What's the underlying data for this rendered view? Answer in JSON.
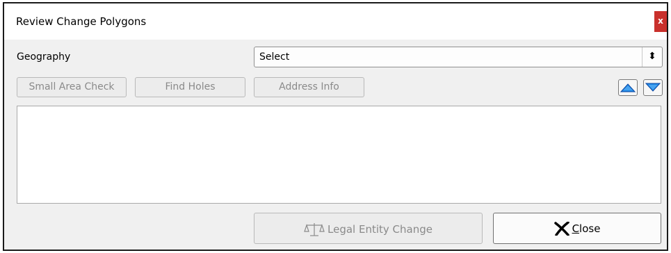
{
  "window": {
    "title": "Review Change Polygons",
    "close_glyph": "x"
  },
  "geography": {
    "label": "Geography",
    "selected": "Select"
  },
  "toolbar": {
    "small_area_check": "Small Area Check",
    "find_holes": "Find Holes",
    "address_info": "Address Info",
    "move_up_icon": "up-arrow-icon",
    "move_down_icon": "down-arrow-icon"
  },
  "results_list": {
    "items": []
  },
  "actions": {
    "legal_entity_change": "Legal Entity Change",
    "close_accel": "C",
    "close_rest": "lose"
  },
  "colors": {
    "close_x_bg": "#c9302c",
    "arrow_blue": "#1e88e5",
    "disabled_text": "#8a8a8a"
  }
}
